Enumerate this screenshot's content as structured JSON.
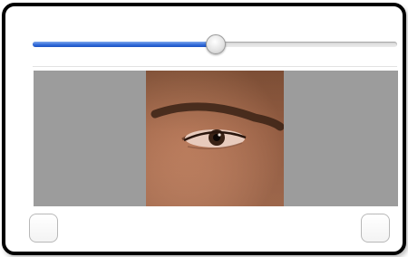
{
  "slider": {
    "value": 0.5
  },
  "viewer": {
    "image_icon": "face-eye-photo"
  },
  "checkboxes": [
    {
      "checked": false
    },
    {
      "checked": false
    }
  ],
  "colors": {
    "slider_fill": "#2f67d8",
    "viewer_background": "#9c9c9c",
    "frame_border": "#000000"
  }
}
